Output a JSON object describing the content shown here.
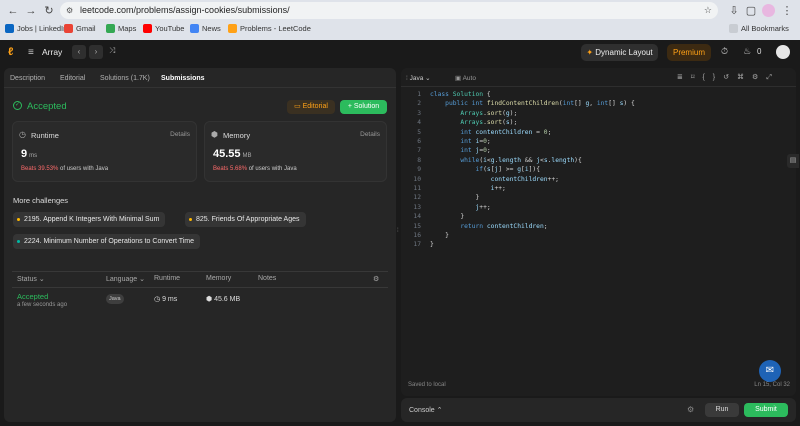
{
  "browser": {
    "url": "leetcode.com/problems/assign-cookies/submissions/",
    "bookmarks": [
      {
        "label": "Jobs | LinkedIn",
        "color": "#0a66c2"
      },
      {
        "label": "Gmail",
        "color": "#ea4335"
      },
      {
        "label": "Maps",
        "color": "#34a853"
      },
      {
        "label": "YouTube",
        "color": "#ff0000"
      },
      {
        "label": "News",
        "color": "#4285f4"
      },
      {
        "label": "Problems - LeetCode",
        "color": "#ffa116"
      }
    ],
    "all_bookmarks": "All Bookmarks"
  },
  "lc": {
    "problem_list": "Array",
    "dynamic_layout": "Dynamic Layout",
    "premium": "Premium",
    "streak": "0"
  },
  "left": {
    "tabs": [
      "Description",
      "Editorial",
      "Solutions (1.7K)",
      "Submissions"
    ],
    "status": "Accepted",
    "editorial_btn": "Editorial",
    "solution_btn": "Solution",
    "runtime": {
      "label": "Runtime",
      "details": "Details",
      "value": "9",
      "unit": "ms",
      "beats_pct": "Beats 39.53%",
      "beats_rest": "of users with Java"
    },
    "memory": {
      "label": "Memory",
      "details": "Details",
      "value": "45.55",
      "unit": "MB",
      "beats_pct": "Beats 5.68%",
      "beats_rest": "of users with Java"
    },
    "more": "More challenges",
    "challenges": [
      {
        "label": "2195. Append K Integers With Minimal Sum",
        "color": "#ffb800"
      },
      {
        "label": "825. Friends Of Appropriate Ages",
        "color": "#ffb800"
      },
      {
        "label": "2224. Minimum Number of Operations to Convert Time",
        "color": "#00b8a3"
      }
    ],
    "headers": {
      "status": "Status",
      "language": "Language",
      "runtime": "Runtime",
      "memory": "Memory",
      "notes": "Notes"
    },
    "row": {
      "status": "Accepted",
      "time_ago": "a few seconds ago",
      "language": "Java",
      "runtime": "9 ms",
      "memory": "45.6 MB"
    }
  },
  "editor": {
    "language": "Java",
    "mode": "Auto",
    "lines": [
      [
        [
          "kw",
          "class "
        ],
        [
          "ty",
          "Solution"
        ],
        [
          "",
          " {"
        ]
      ],
      [
        [
          "",
          "    "
        ],
        [
          "kw",
          "public int "
        ],
        [
          "fn",
          "findContentChildren"
        ],
        [
          "",
          "("
        ],
        [
          "kw",
          "int"
        ],
        [
          "",
          "[] "
        ],
        [
          "vr",
          "g"
        ],
        [
          "",
          ", "
        ],
        [
          "kw",
          "int"
        ],
        [
          "",
          "[] "
        ],
        [
          "vr",
          "s"
        ],
        [
          "",
          ") {"
        ]
      ],
      [
        [
          "",
          "        "
        ],
        [
          "ty",
          "Arrays"
        ],
        [
          "",
          "."
        ],
        [
          "fn",
          "sort"
        ],
        [
          "",
          "("
        ],
        [
          "vr",
          "g"
        ],
        [
          "",
          ");"
        ]
      ],
      [
        [
          "",
          "        "
        ],
        [
          "ty",
          "Arrays"
        ],
        [
          "",
          "."
        ],
        [
          "fn",
          "sort"
        ],
        [
          "",
          "("
        ],
        [
          "vr",
          "s"
        ],
        [
          "",
          ");"
        ]
      ],
      [
        [
          "",
          "        "
        ],
        [
          "kw",
          "int "
        ],
        [
          "vr",
          "contentChildren"
        ],
        [
          "",
          " = "
        ],
        [
          "nm",
          "0"
        ],
        [
          "",
          ";"
        ]
      ],
      [
        [
          "",
          "        "
        ],
        [
          "kw",
          "int "
        ],
        [
          "vr",
          "i"
        ],
        [
          "",
          "="
        ],
        [
          "nm",
          "0"
        ],
        [
          "",
          ";"
        ]
      ],
      [
        [
          "",
          "        "
        ],
        [
          "kw",
          "int "
        ],
        [
          "vr",
          "j"
        ],
        [
          "",
          "="
        ],
        [
          "nm",
          "0"
        ],
        [
          "",
          ";"
        ]
      ],
      [
        [
          "",
          "        "
        ],
        [
          "kw",
          "while"
        ],
        [
          "",
          "("
        ],
        [
          "vr",
          "i"
        ],
        [
          "",
          "<"
        ],
        [
          "vr",
          "g"
        ],
        [
          "",
          "."
        ],
        [
          "vr",
          "length"
        ],
        [
          "",
          " && "
        ],
        [
          "vr",
          "j"
        ],
        [
          "",
          "<"
        ],
        [
          "vr",
          "s"
        ],
        [
          "",
          "."
        ],
        [
          "vr",
          "length"
        ],
        [
          "",
          "){"
        ]
      ],
      [
        [
          "",
          "            "
        ],
        [
          "kw",
          "if"
        ],
        [
          "",
          "("
        ],
        [
          "vr",
          "s"
        ],
        [
          "",
          "["
        ],
        [
          "vr",
          "j"
        ],
        [
          "",
          "] >= "
        ],
        [
          "vr",
          "g"
        ],
        [
          "",
          "["
        ],
        [
          "vr",
          "i"
        ],
        [
          "",
          "]){"
        ]
      ],
      [
        [
          "",
          "                "
        ],
        [
          "vr",
          "contentChildren"
        ],
        [
          "",
          "++;"
        ]
      ],
      [
        [
          "",
          "                "
        ],
        [
          "vr",
          "i"
        ],
        [
          "",
          "++;"
        ]
      ],
      [
        [
          "",
          "            }"
        ]
      ],
      [
        [
          "",
          "            "
        ],
        [
          "vr",
          "j"
        ],
        [
          "",
          "++;"
        ]
      ],
      [
        [
          "",
          "        }"
        ]
      ],
      [
        [
          "",
          "        "
        ],
        [
          "kw",
          "return "
        ],
        [
          "vr",
          "contentChildren"
        ],
        [
          "",
          ";"
        ]
      ],
      [
        [
          "",
          "    }"
        ]
      ],
      [
        [
          "",
          "}"
        ]
      ]
    ],
    "saved": "Saved to local",
    "cursor": "Ln 15, Col 32"
  },
  "console": {
    "label": "Console",
    "run": "Run",
    "submit": "Submit"
  }
}
